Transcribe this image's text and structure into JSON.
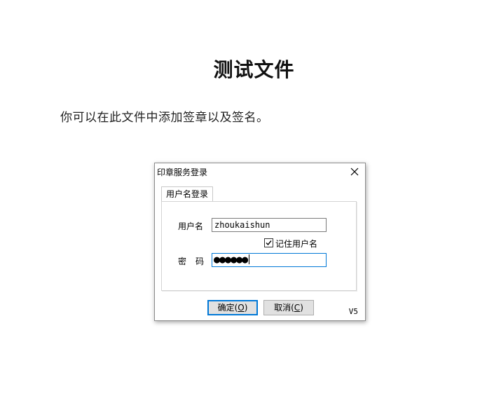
{
  "document": {
    "title": "测试文件",
    "body_text": "你可以在此文件中添加签章以及签名。"
  },
  "dialog": {
    "title": "印章服务登录",
    "close_icon": "close-icon",
    "tab_label": "用户名登录",
    "username_label": "用户名",
    "username_value": "zhoukaishun",
    "remember_label": "记住用户名",
    "remember_checked": true,
    "password_label": "密码",
    "password_value": "●●●●●●",
    "ok_button": {
      "label": "确定(",
      "mnemonic": "O",
      "suffix": ")"
    },
    "cancel_button": {
      "label": "取消(",
      "mnemonic": "C",
      "suffix": ")"
    },
    "version": "V5"
  },
  "colors": {
    "focus_border": "#0078d7",
    "button_bg": "#e1e1e1"
  }
}
